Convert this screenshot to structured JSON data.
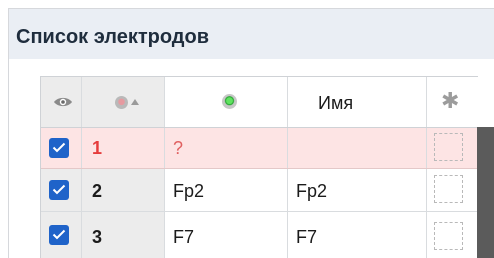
{
  "panel": {
    "title": "Список электродов"
  },
  "table": {
    "header": {
      "visibility_icon": "eye-icon",
      "sort_column_icon": "grey-dot-icon",
      "sort_direction_icon": "sort-up-icon",
      "status_icon": "green-dot-icon",
      "name_label": "Имя",
      "settings_icon": "asterisk-icon"
    },
    "rows": [
      {
        "checked": true,
        "number": "1",
        "label": "?",
        "name": "",
        "invalid": true
      },
      {
        "checked": true,
        "number": "2",
        "label": "Fp2",
        "name": "Fp2",
        "invalid": false
      },
      {
        "checked": true,
        "number": "3",
        "label": "F7",
        "name": "F7",
        "invalid": false
      }
    ]
  },
  "colors": {
    "header_bg": "#eaeef4",
    "invalid_row_bg": "#fde4e4",
    "invalid_text": "#e53c3c",
    "checkbox_accent": "#1f63c9"
  }
}
